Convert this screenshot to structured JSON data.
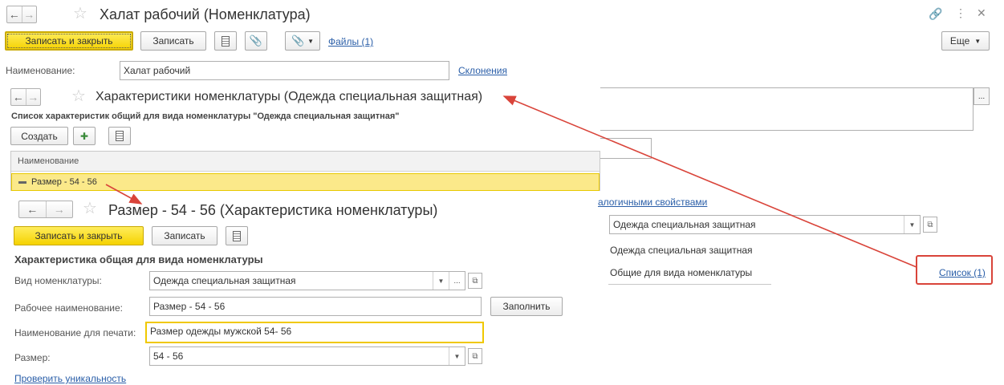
{
  "main": {
    "title": "Халат рабочий (Номенклатура)",
    "toolbar": {
      "save_close": "Записать и закрыть",
      "save": "Записать",
      "files_link": "Файлы (1)",
      "more": "Еще"
    },
    "name_label": "Наименование:",
    "name_value": "Халат рабочий",
    "declension_link": "Склонения",
    "similar_link_fragment": "алогичными свойствами",
    "kind_value": "Одежда специальная защитная",
    "kind_text": "Одежда специальная защитная",
    "characteristics_text": "Общие для вида номенклатуры",
    "list_link": "Список (1)"
  },
  "char_list": {
    "title": "Характеристики номенклатуры (Одежда специальная защитная)",
    "subtitle": "Список характеристик общий для вида номенклатуры \"Одежда специальная защитная\"",
    "create_button": "Создать",
    "column_header": "Наименование",
    "rows": [
      "Размер - 54 - 56"
    ]
  },
  "char_form": {
    "title": "Размер - 54 - 56 (Характеристика номенклатуры)",
    "save_close": "Записать и закрыть",
    "save": "Записать",
    "section_title": "Характеристика общая для вида номенклатуры",
    "kind_label": "Вид номенклатуры:",
    "kind_value": "Одежда специальная защитная",
    "work_name_label": "Рабочее наименование:",
    "work_name_value": "Размер - 54 - 56",
    "fill_button": "Заполнить",
    "print_name_label": "Наименование для печати:",
    "print_name_value": "Размер одежды мужской 54- 56",
    "size_label": "Размер:",
    "size_value": "54 - 56",
    "check_link": "Проверить уникальность"
  },
  "colors": {
    "accent_yellow": "#f5d200",
    "link_blue": "#2a5ea8",
    "annotation_red": "#d9443a",
    "row_highlight": "#fbe98a"
  }
}
